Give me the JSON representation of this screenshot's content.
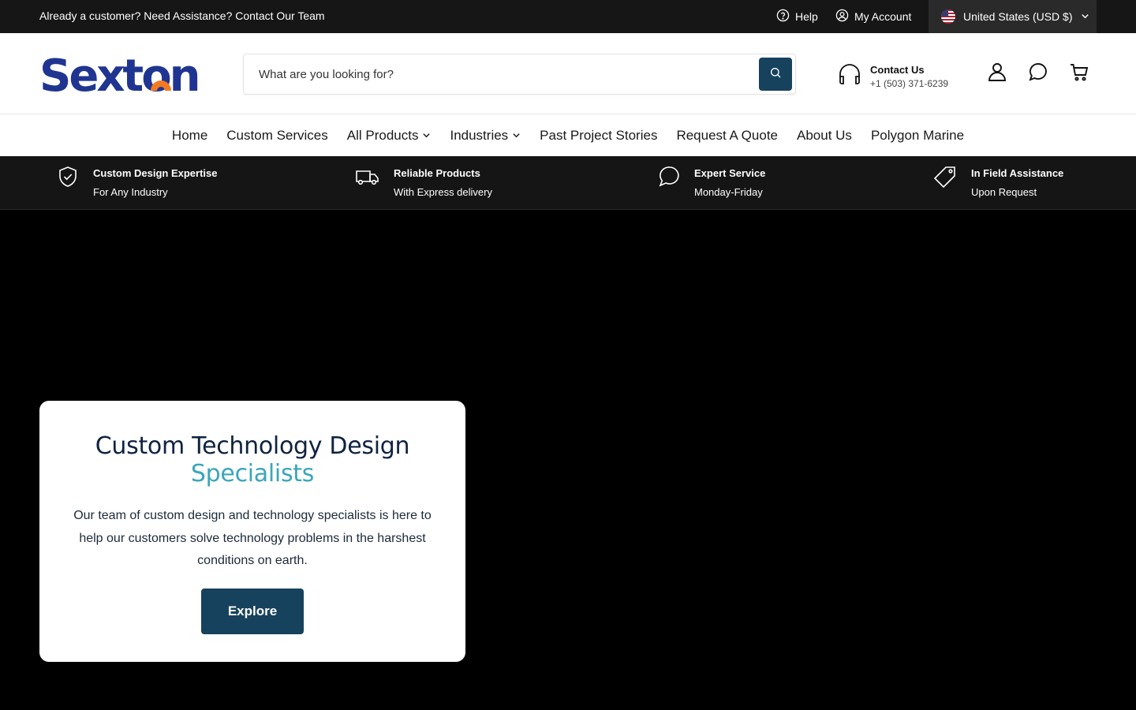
{
  "topbar": {
    "announcement": "Already a customer? Need Assistance? Contact Our Team",
    "help_label": "Help",
    "account_label": "My Account",
    "locale_label": "United States (USD $)"
  },
  "header": {
    "logo_text": "Sexton",
    "search_placeholder": "What are you looking for?",
    "contact_title": "Contact Us",
    "contact_phone": "+1 (503) 371-6239"
  },
  "nav": {
    "items": [
      {
        "label": "Home"
      },
      {
        "label": "Custom Services"
      },
      {
        "label": "All Products"
      },
      {
        "label": "Industries"
      },
      {
        "label": "Past Project Stories"
      },
      {
        "label": "Request A Quote"
      },
      {
        "label": "About Us"
      },
      {
        "label": "Polygon Marine"
      }
    ]
  },
  "features": [
    {
      "title": "Custom Design Expertise",
      "subtitle": "For Any Industry",
      "icon": "shield-check-icon"
    },
    {
      "title": "Reliable Products",
      "subtitle": "With Express delivery",
      "icon": "truck-icon"
    },
    {
      "title": "Expert Service",
      "subtitle": "Monday-Friday",
      "icon": "chat-icon"
    },
    {
      "title": "In Field Assistance",
      "subtitle": "Upon Request",
      "icon": "tag-icon"
    }
  ],
  "hero": {
    "heading_line1": "Custom Technology Design",
    "heading_line2": "Specialists",
    "body": "Our team of custom design and technology specialists is here to help our customers solve technology problems in the harshest conditions on earth.",
    "cta_label": "Explore"
  },
  "colors": {
    "brand_navy": "#17425e",
    "accent_teal": "#3aa6b9",
    "logo_blue": "#1f3591",
    "logo_orange": "#f47b20"
  }
}
